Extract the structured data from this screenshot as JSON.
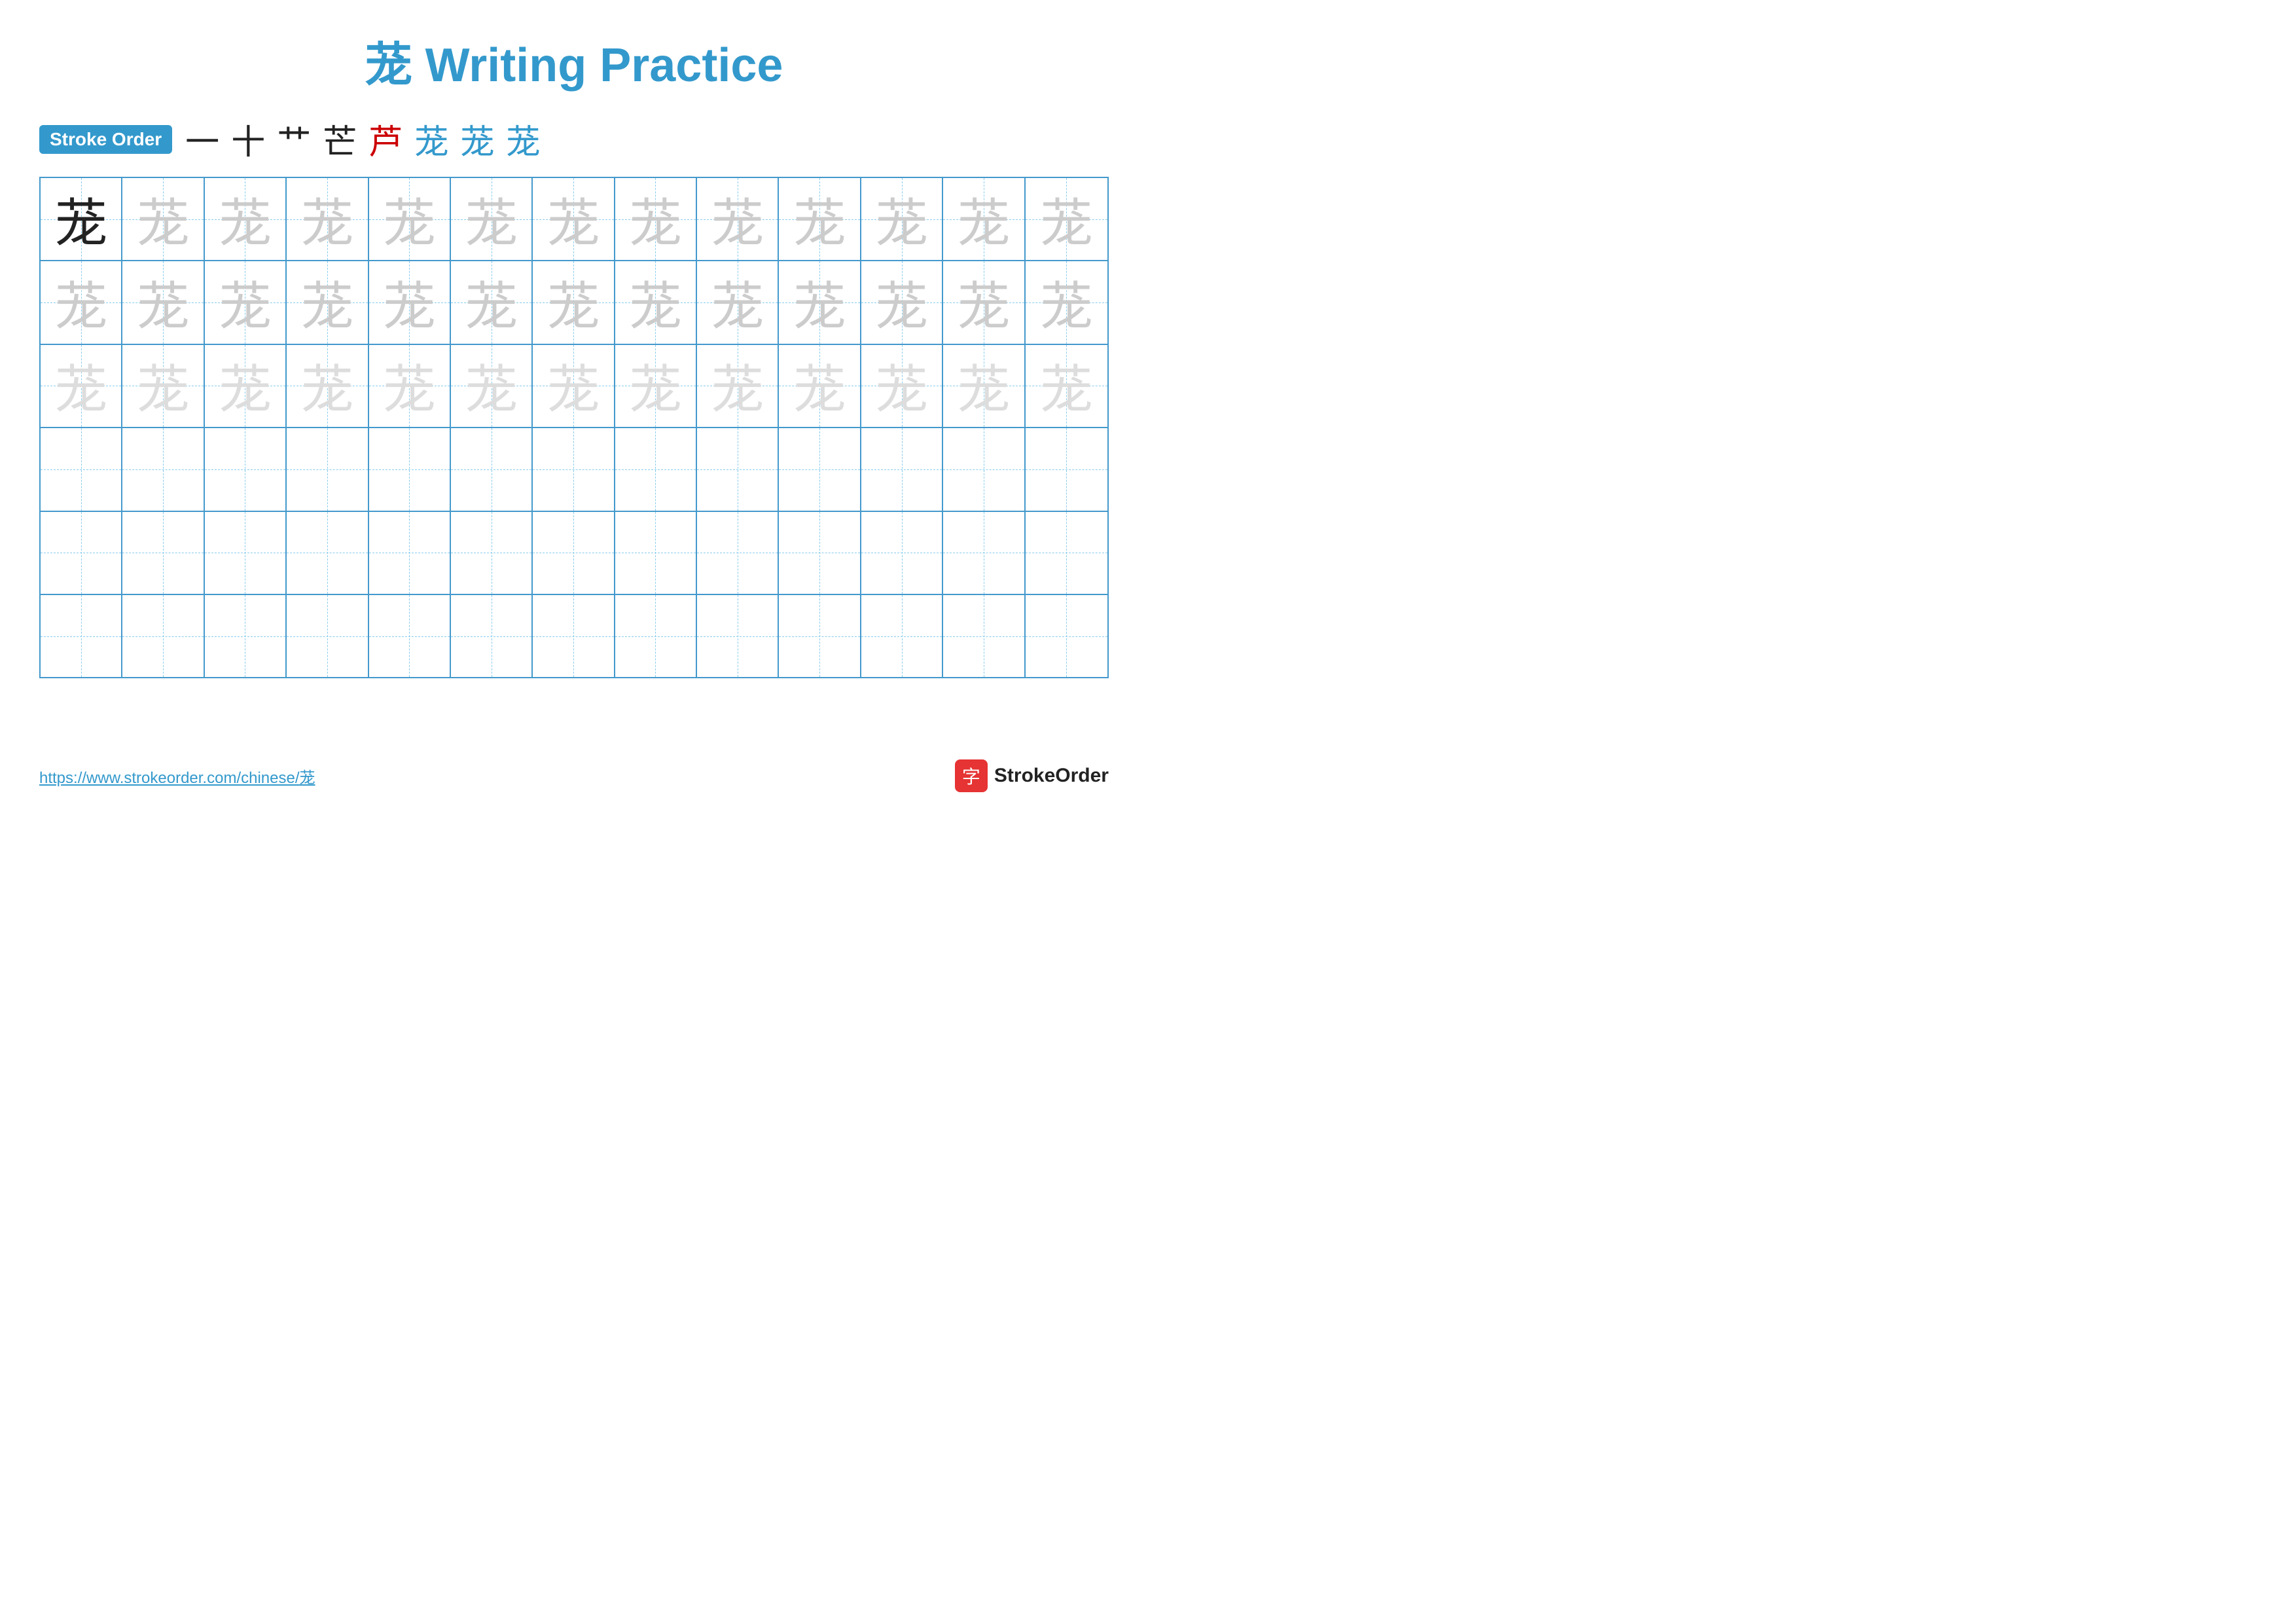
{
  "title": {
    "main": "茏 Writing Practice",
    "char": "茏",
    "suffix": " Writing Practice"
  },
  "stroke_order": {
    "badge_label": "Stroke Order",
    "strokes": [
      {
        "char": "一",
        "style": "black"
      },
      {
        "char": "十",
        "style": "black"
      },
      {
        "char": "艹",
        "style": "black"
      },
      {
        "char": "芒",
        "style": "black"
      },
      {
        "char": "芦",
        "style": "red"
      },
      {
        "char": "茏",
        "style": "blue"
      },
      {
        "char": "茏",
        "style": "blue"
      },
      {
        "char": "茏",
        "style": "blue"
      }
    ]
  },
  "grid": {
    "rows": 6,
    "cols": 13,
    "char": "茏",
    "row_types": [
      "solid-then-light",
      "light",
      "lighter",
      "empty",
      "empty",
      "empty"
    ]
  },
  "footer": {
    "url": "https://www.strokeorder.com/chinese/茏",
    "logo_char": "字",
    "logo_text": "StrokeOrder"
  }
}
